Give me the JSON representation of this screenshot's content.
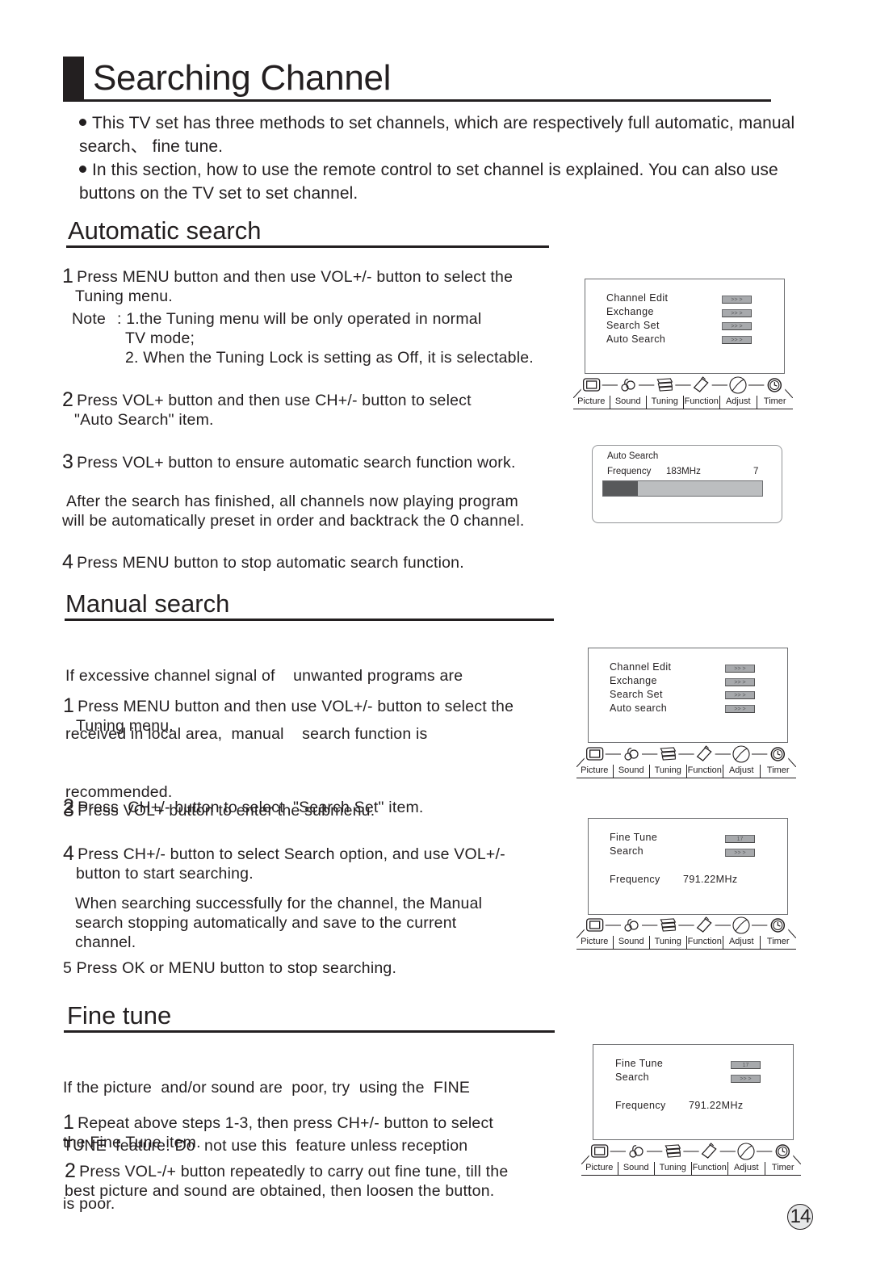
{
  "page": {
    "title": "Searching Channel",
    "page_number": "14",
    "intro": [
      "This TV set has three methods to set channels, which are respectively full automatic, manual search、 fine tune.",
      "In this section, how to use the remote control  to set channel is explained. You can also use buttons on the TV set to set channel."
    ]
  },
  "auto_search": {
    "heading": "Automatic search",
    "step1_num": "1",
    "step1": "Press MENU button and then use VOL+/- button to select the",
    "step1_cont": "Tuning menu.",
    "note_label": "Note",
    "note1": ": 1.the Tuning  menu will be only operated  in normal",
    "note1_cont": "TV mode;",
    "note2": "2. When the Tuning Lock is setting as Off, it is selectable.",
    "step2_num": "2",
    "step2": "Press VOL+ button and then use CH+/- button to select",
    "step2_cont": "\"Auto Search\" item.",
    "step3_num": "3",
    "step3": "Press VOL+ button to ensure automatic search function work.",
    "after_1": "After the search has finished, all channels now playing program",
    "after_2": "will be automatically preset in order and backtrack the 0 channel.",
    "step4_num": "4",
    "step4": "Press MENU button to stop automatic search function."
  },
  "manual_search": {
    "heading": "Manual search",
    "intro_1": "If excessive channel signal of    unwanted programs are",
    "intro_2": "received in local area,  manual    search function is",
    "intro_3": "recommended.",
    "step1_num": "1",
    "step1": "Press MENU button and then use VOL+/- button to select the",
    "step1_cont": "Tuning menu.",
    "step2_num": "2",
    "step2": "Press  CH+/- button to select  \"Search Set\" item.",
    "step3_num": "3",
    "step3": "Press VOL+ button to enter the submenu.",
    "step4_num": "4",
    "step4": "Press CH+/- button to select Search option, and use VOL+/-",
    "step4_cont": "button to start searching.",
    "when_1": "When searching successfully for the channel, the Manual",
    "when_2": "search stopping automatically and save to the current",
    "when_3": "channel.",
    "step5": "5 Press OK or MENU button to stop searching."
  },
  "fine_tune": {
    "heading": "Fine tune",
    "intro_1": "If the picture  and/or sound are  poor, try  using the  FINE",
    "intro_2": "TUNE  feature. Do  not use this  feature unless reception",
    "intro_3": "is poor.",
    "step1_num": "1",
    "step1": "Repeat above steps 1-3,  then press CH+/- button to select",
    "step1_cont": "the Fine Tune  item.",
    "step2_num": "2",
    "step2": "Press VOL-/+ button repeatedly to carry out fine tune, till the",
    "step2_cont": "best picture and sound are obtained, then loosen the button."
  },
  "osd_tabs": [
    "Picture",
    "Sound",
    "Tuning",
    "Function",
    "Adjust",
    "Timer"
  ],
  "osd_tab_icons": [
    "tv-icon",
    "music-notes-icon",
    "film-reel-icon",
    "remote-icon",
    "globe-icon",
    "clock-icon"
  ],
  "tuning_menu_1": {
    "items": [
      "Channel Edit",
      "Exchange",
      "Search Set",
      "Auto Search"
    ],
    "arrow": ">> >"
  },
  "auto_search_screen": {
    "title": "Auto Search",
    "freq_label": "Frequency",
    "freq_value": "183MHz",
    "channel": "7",
    "progress_fraction": 0.22
  },
  "tuning_menu_2": {
    "items": [
      "Channel Edit",
      "Exchange",
      "Search Set",
      "Auto search"
    ],
    "arrow": ">> >"
  },
  "search_set_1": {
    "fine_tune_label": "Fine Tune",
    "fine_tune_value": "17",
    "search_label": "Search",
    "search_value": ">> >",
    "freq_label": "Frequency",
    "freq_value": "791.22MHz"
  },
  "search_set_2": {
    "fine_tune_label": "Fine Tune",
    "fine_tune_value": "17",
    "search_label": "Search",
    "search_value": ">> >",
    "freq_label": "Frequency",
    "freq_value": "791.22MHz"
  }
}
